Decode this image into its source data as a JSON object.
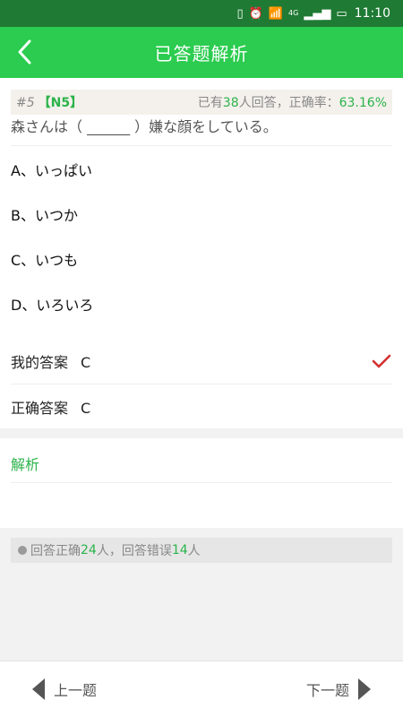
{
  "status_bar": {
    "time": "11:10",
    "network": "4G"
  },
  "header": {
    "title": "已答题解析"
  },
  "question": {
    "number": "#5",
    "level": "【N5】",
    "stats_prefix": "已有",
    "answered_count": "38",
    "stats_middle": "人回答，正确率：",
    "accuracy": "63.16%",
    "text": "森さんは（ ______ ）嫌な顔をしている。",
    "options": [
      {
        "label": "A、いっぱい"
      },
      {
        "label": "B、いつか"
      },
      {
        "label": "C、いつも"
      },
      {
        "label": "D、いろいろ"
      }
    ]
  },
  "answers": {
    "my_answer_label": "我的答案",
    "my_answer_value": "C",
    "correct_answer_label": "正确答案",
    "correct_answer_value": "C"
  },
  "analysis": {
    "label": "解析"
  },
  "result": {
    "correct_prefix": "回答正确",
    "correct_count": "24",
    "correct_suffix": "人，",
    "wrong_prefix": "回答错误",
    "wrong_count": "14",
    "wrong_suffix": "人"
  },
  "footer": {
    "prev_label": "上一题",
    "next_label": "下一题"
  },
  "colors": {
    "nav_green": "#2bcc4f",
    "status_green": "#1f7a34",
    "accent_green": "#2bb34a",
    "check_red": "#d32f2f"
  }
}
